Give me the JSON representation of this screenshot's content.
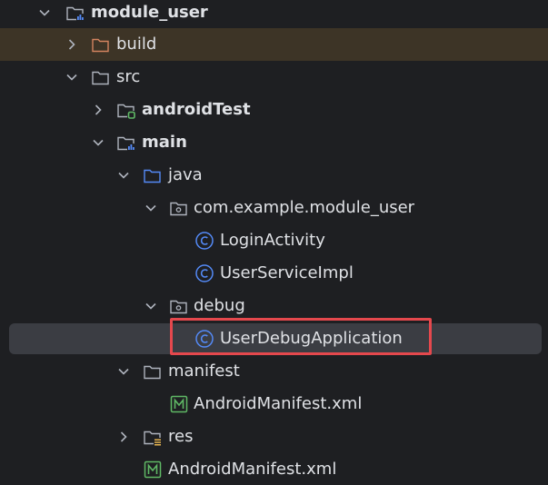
{
  "colors": {
    "background": "#1e1f22",
    "text": "#dfe1e5",
    "folder_stroke": "#aeb3bd",
    "build_folder": "#d3835f",
    "source_folder": "#548af7",
    "class_icon": "#548af7",
    "manifest_icon": "#5fb865",
    "test_badge": "#5fb865",
    "selection_border": "#e5484d"
  },
  "tree": {
    "items": [
      {
        "label": "module_user",
        "icon": "module-folder-icon",
        "expanded": true,
        "bold": true
      },
      {
        "label": "build",
        "icon": "excluded-folder-icon",
        "expanded": false,
        "bold": false
      },
      {
        "label": "src",
        "icon": "folder-icon",
        "expanded": true,
        "bold": false
      },
      {
        "label": "androidTest",
        "icon": "test-folder-icon",
        "expanded": false,
        "bold": true
      },
      {
        "label": "main",
        "icon": "module-folder-icon",
        "expanded": true,
        "bold": true
      },
      {
        "label": "java",
        "icon": "source-folder-icon",
        "expanded": true,
        "bold": false
      },
      {
        "label": "com.example.module_user",
        "icon": "package-icon",
        "expanded": true,
        "bold": false
      },
      {
        "label": "LoginActivity",
        "icon": "class-icon",
        "bold": false
      },
      {
        "label": "UserServiceImpl",
        "icon": "class-icon",
        "bold": false
      },
      {
        "label": "debug",
        "icon": "package-icon",
        "expanded": true,
        "bold": false
      },
      {
        "label": "UserDebugApplication",
        "icon": "class-icon",
        "bold": false,
        "selected": true,
        "highlighted": true
      },
      {
        "label": "manifest",
        "icon": "folder-icon",
        "expanded": true,
        "bold": false
      },
      {
        "label": "AndroidManifest.xml",
        "icon": "manifest-file-icon",
        "bold": false
      },
      {
        "label": "res",
        "icon": "resources-folder-icon",
        "expanded": false,
        "bold": false
      },
      {
        "label": "AndroidManifest.xml",
        "icon": "manifest-file-icon",
        "bold": false
      }
    ]
  }
}
